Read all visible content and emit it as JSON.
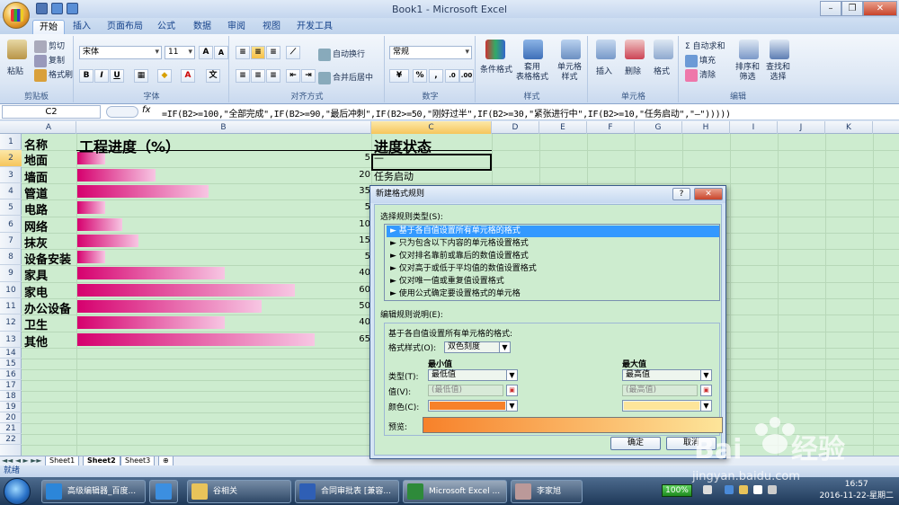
{
  "window": {
    "title": "Book1 - Microsoft Excel"
  },
  "ribbon_tabs": [
    "开始",
    "插入",
    "页面布局",
    "公式",
    "数据",
    "审阅",
    "视图",
    "开发工具"
  ],
  "clipboard": {
    "paste": "粘贴",
    "cut": "剪切",
    "copy": "复制",
    "format_painter": "格式刷",
    "label": "剪贴板"
  },
  "font": {
    "name": "宋体",
    "size": "11",
    "label": "字体",
    "bold": "B",
    "italic": "I",
    "underline": "U"
  },
  "alignment": {
    "wrap": "自动换行",
    "merge": "合并后居中",
    "label": "对齐方式"
  },
  "number": {
    "format": "常规",
    "percent": "%",
    "comma": ",",
    "label": "数字"
  },
  "styles": {
    "cond": "条件格式",
    "table": "套用\n表格格式",
    "cell": "单元格\n样式",
    "label": "样式"
  },
  "cells": {
    "insert": "插入",
    "delete": "删除",
    "format": "格式",
    "label": "单元格"
  },
  "editing": {
    "autosum": "Σ 自动求和",
    "fill": "填充",
    "clear": "清除",
    "sort": "排序和\n筛选",
    "find": "查找和\n选择",
    "label": "编辑"
  },
  "formula_bar": {
    "name_box": "C2",
    "fx": "fx",
    "formula": "=IF(B2>=100,\"全部完成\",IF(B2>=90,\"最后冲刺\",IF(B2>=50,\"刚好过半\",IF(B2>=30,\"紧张进行中\",IF(B2>=10,\"任务启动\",\"—\")))))"
  },
  "columns": [
    "A",
    "B",
    "C",
    "D",
    "E",
    "F",
    "G",
    "H",
    "I",
    "J",
    "K"
  ],
  "rows": [
    "1",
    "2",
    "3",
    "4",
    "5",
    "6",
    "7",
    "8",
    "9",
    "10",
    "11",
    "12",
    "13",
    "14",
    "15",
    "16",
    "17",
    "18",
    "19",
    "20",
    "21",
    "22"
  ],
  "sheet": {
    "header_a": "名称",
    "header_b": "工程进度（%）",
    "header_c": "进度状态",
    "data": [
      {
        "name": "地面",
        "value": "5",
        "status": "—"
      },
      {
        "name": "墙面",
        "value": "20",
        "status": "任务启动"
      },
      {
        "name": "管道",
        "value": "35",
        "status": ""
      },
      {
        "name": "电路",
        "value": "5",
        "status": ""
      },
      {
        "name": "网络",
        "value": "10",
        "status": ""
      },
      {
        "name": "抹灰",
        "value": "15",
        "status": ""
      },
      {
        "name": "设备安装",
        "value": "5",
        "status": ""
      },
      {
        "name": "家具",
        "value": "40",
        "status": ""
      },
      {
        "name": "家电",
        "value": "60",
        "status": ""
      },
      {
        "name": "办公设备",
        "value": "50",
        "status": ""
      },
      {
        "name": "卫生",
        "value": "40",
        "status": ""
      },
      {
        "name": "其他",
        "value": "65",
        "status": ""
      }
    ],
    "bar_fractions": [
      0.1,
      0.28,
      0.47,
      0.1,
      0.16,
      0.22,
      0.1,
      0.53,
      0.78,
      0.66,
      0.53,
      0.85
    ]
  },
  "sheet_tabs": [
    "Sheet1",
    "Sheet2",
    "Sheet3"
  ],
  "status": {
    "ready": "就绪"
  },
  "dialog": {
    "title": "新建格式规则",
    "help": "?",
    "close": "✕",
    "select_type_label": "选择规则类型(S):",
    "rule_types": [
      "► 基于各自值设置所有单元格的格式",
      "► 只为包含以下内容的单元格设置格式",
      "► 仅对排名靠前或靠后的数值设置格式",
      "► 仅对高于或低于平均值的数值设置格式",
      "► 仅对唯一值或重复值设置格式",
      "► 使用公式确定要设置格式的单元格"
    ],
    "edit_label": "编辑规则说明(E):",
    "desc_title": "基于各自值设置所有单元格的格式:",
    "format_style_label": "格式样式(O):",
    "format_style_value": "双色刻度",
    "min_label": "最小值",
    "max_label": "最大值",
    "type_label": "类型(T):",
    "value_label": "值(V):",
    "color_label": "颜色(C):",
    "min_type": "最低值",
    "max_type": "最高值",
    "min_value": "(最低值)",
    "max_value": "(最高值)",
    "min_color": "#f7812a",
    "max_color": "#fde59a",
    "preview_label": "预览:",
    "ok": "确定",
    "cancel": "取消"
  },
  "taskbar": {
    "items": [
      "高级编辑器_百度...",
      "谷相关",
      "合同审批表 [兼容...",
      "Microsoft Excel ...",
      "李家旭"
    ],
    "battery": "100%",
    "time": "16:57",
    "date": "2016-11-22-星期二"
  }
}
